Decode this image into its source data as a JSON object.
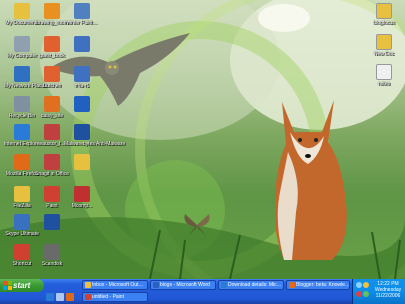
{
  "desktop": {
    "icons_left": [
      {
        "label": "My Documents",
        "icon": "my-documents-icon",
        "color": "#e8c040"
      },
      {
        "label": "drawing_room",
        "icon": "paint-file-icon",
        "color": "#e89020"
      },
      {
        "label": "winter Paint…",
        "icon": "paint-file-icon",
        "color": "#5080c0"
      },
      {
        "label": "My Computer",
        "icon": "my-computer-icon",
        "color": "#90a0b0"
      },
      {
        "label": "guest_book",
        "icon": "paint-file-icon",
        "color": "#e06030"
      },
      {
        "label": "",
        "icon": "paint-file-icon",
        "color": "#4070c0"
      },
      {
        "label": "My Network Places",
        "icon": "network-places-icon",
        "color": "#3070c0"
      },
      {
        "label": "Dutchen",
        "icon": "paint-file-icon",
        "color": "#e06030"
      },
      {
        "label": "nYa-r1",
        "icon": "paint-file-icon",
        "color": "#4070c0"
      },
      {
        "label": "Recycle Bin",
        "icon": "recycle-bin-icon",
        "color": "#8090a0"
      },
      {
        "label": "daisy_site",
        "icon": "paint-file-icon",
        "color": "#e07020"
      },
      {
        "label": "",
        "icon": "app-icon",
        "color": "#2060c0"
      },
      {
        "label": "Internet Explorer",
        "icon": "internet-explorer-icon",
        "color": "#2a7ad8"
      },
      {
        "label": "eaustor_f...",
        "icon": "paint-file-icon",
        "color": "#c04040"
      },
      {
        "label": "Malwarebytes Anti-Malware",
        "icon": "app-icon",
        "color": "#2050a0"
      },
      {
        "label": "Mozilla Firefox",
        "icon": "firefox-icon",
        "color": "#e06a18"
      },
      {
        "label": "Snagit in Office",
        "icon": "app-icon",
        "color": "#c04040"
      },
      {
        "label": "",
        "icon": "folder-icon",
        "color": "#e8c040"
      },
      {
        "label": "FileZilla",
        "icon": "folder-icon",
        "color": "#e8c040"
      },
      {
        "label": "Paint",
        "icon": "paint-icon",
        "color": "#d04030"
      },
      {
        "label": "Mcomp...",
        "icon": "app-icon",
        "color": "#c03030"
      },
      {
        "label": "Skype Ultimate",
        "icon": "app-icon",
        "color": "#3a70c0"
      },
      {
        "label": "",
        "icon": "app-icon",
        "color": "#2050a0"
      },
      {
        "label": "",
        "icon": "",
        "color": ""
      },
      {
        "label": "Shortcut",
        "icon": "app-icon",
        "color": "#d04030"
      },
      {
        "label": "Scandisk",
        "icon": "app-icon",
        "color": "#6a6a6a"
      },
      {
        "label": "",
        "icon": "",
        "color": ""
      }
    ],
    "icons_right": [
      {
        "label": "blogfocus",
        "icon": "folder-icon",
        "color": "#e8c040"
      },
      {
        "label": "New Doc",
        "icon": "folder-icon",
        "color": "#e8c040"
      },
      {
        "label": "notes",
        "icon": "text-file-icon",
        "color": "#f0f0f0"
      }
    ]
  },
  "taskbar": {
    "start_label": "start",
    "buttons": [
      {
        "label": "Inbox - Microsoft Out…",
        "icon": "outlook-icon",
        "color": "#f0c040"
      },
      {
        "label": "blogs - Microsoft Word",
        "icon": "word-icon",
        "color": "#2a60c0"
      },
      {
        "label": "Download details: Mic…",
        "icon": "ie-icon",
        "color": "#2a7ad8"
      },
      {
        "label": "Blogger: beta: Knowle…",
        "icon": "firefox-icon",
        "color": "#e06a18"
      },
      {
        "label": "untitled - Paint",
        "icon": "paint-icon",
        "color": "#d04030"
      }
    ],
    "clock": {
      "time": "12:22 PM",
      "day": "Wednesday",
      "date": "11/22/2006"
    }
  }
}
